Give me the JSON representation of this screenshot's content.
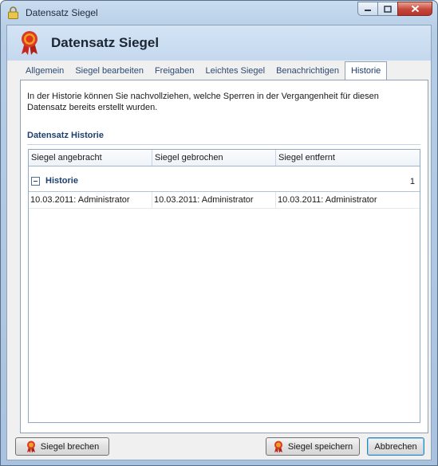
{
  "window": {
    "title": "Datensatz Siegel"
  },
  "icons": {
    "title": "padlock-icon",
    "header": "rosette-seal-icon",
    "buttons": "rosette-seal-icon"
  },
  "colors": {
    "accent": "#1e3f6e",
    "tab_text": "#2c4a72",
    "close_button": "#c6463a"
  },
  "header": {
    "title": "Datensatz Siegel"
  },
  "tabs": [
    {
      "label": "Allgemein"
    },
    {
      "label": "Siegel bearbeiten"
    },
    {
      "label": "Freigaben"
    },
    {
      "label": "Leichtes Siegel"
    },
    {
      "label": "Benachrichtigen"
    },
    {
      "label": "Historie",
      "active": true
    }
  ],
  "historie": {
    "intro": "In der Historie können Sie nachvollziehen, welche Sperren in der Vergangenheit für diesen Datensatz bereits erstellt wurden.",
    "section_title": "Datensatz Historie",
    "columns": [
      "Siegel angebracht",
      "Siegel gebrochen",
      "Siegel entfernt"
    ],
    "group": {
      "label": "Historie",
      "count": "1"
    },
    "rows": [
      [
        "10.03.2011: Administrator",
        "10.03.2011: Administrator",
        "10.03.2011: Administrator"
      ]
    ]
  },
  "buttons": {
    "break_seal": "Siegel brechen",
    "save_seal": "Siegel speichern",
    "cancel": "Abbrechen"
  }
}
